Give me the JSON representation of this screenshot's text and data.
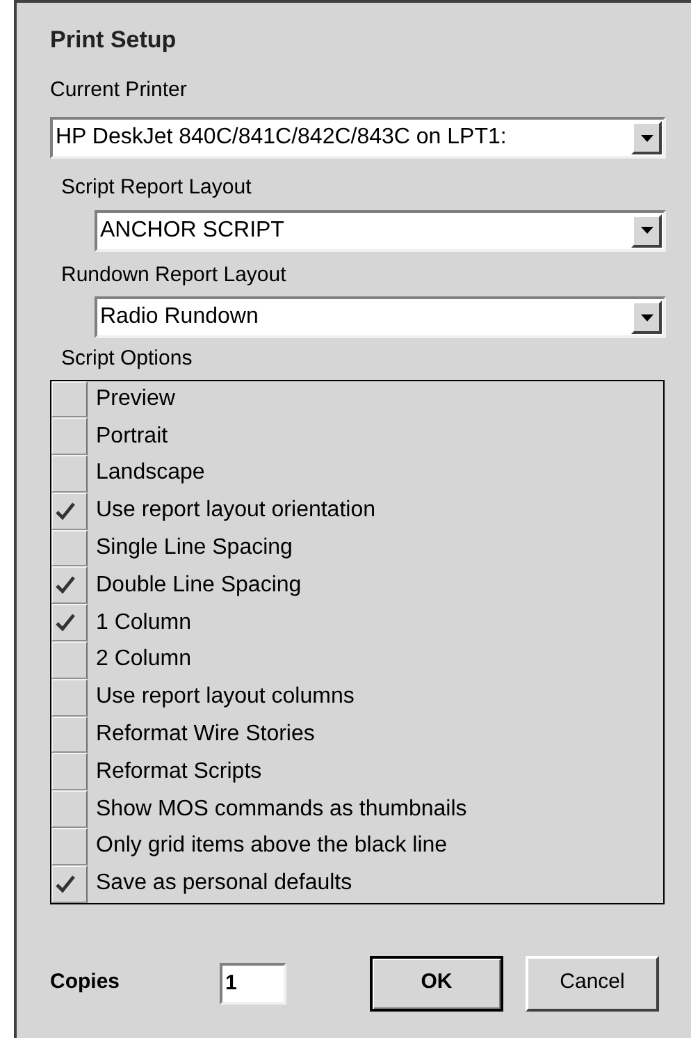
{
  "dialog": {
    "title": "Print Setup"
  },
  "current_printer": {
    "label": "Current Printer",
    "value": "HP DeskJet 840C/841C/842C/843C on LPT1:"
  },
  "script_report_layout": {
    "label": "Script Report Layout",
    "value": "ANCHOR SCRIPT"
  },
  "rundown_report_layout": {
    "label": "Rundown Report Layout",
    "value": "Radio Rundown"
  },
  "script_options": {
    "label": "Script Options",
    "items": [
      {
        "label": "Preview",
        "checked": false
      },
      {
        "label": "Portrait",
        "checked": false
      },
      {
        "label": "Landscape",
        "checked": false
      },
      {
        "label": "Use report layout orientation",
        "checked": true
      },
      {
        "label": "Single Line Spacing",
        "checked": false
      },
      {
        "label": "Double Line Spacing",
        "checked": true
      },
      {
        "label": "1 Column",
        "checked": true
      },
      {
        "label": "2 Column",
        "checked": false
      },
      {
        "label": "Use report layout columns",
        "checked": false
      },
      {
        "label": "Reformat Wire Stories",
        "checked": false
      },
      {
        "label": "Reformat Scripts",
        "checked": false
      },
      {
        "label": "Show MOS commands as thumbnails",
        "checked": false
      },
      {
        "label": "Only grid items above the black line",
        "checked": false
      },
      {
        "label": "Save as personal defaults",
        "checked": true
      }
    ]
  },
  "copies": {
    "label": "Copies",
    "value": "1"
  },
  "buttons": [
    {
      "label": "OK",
      "kind": "default"
    },
    {
      "label": "Cancel",
      "kind": "normal"
    }
  ]
}
